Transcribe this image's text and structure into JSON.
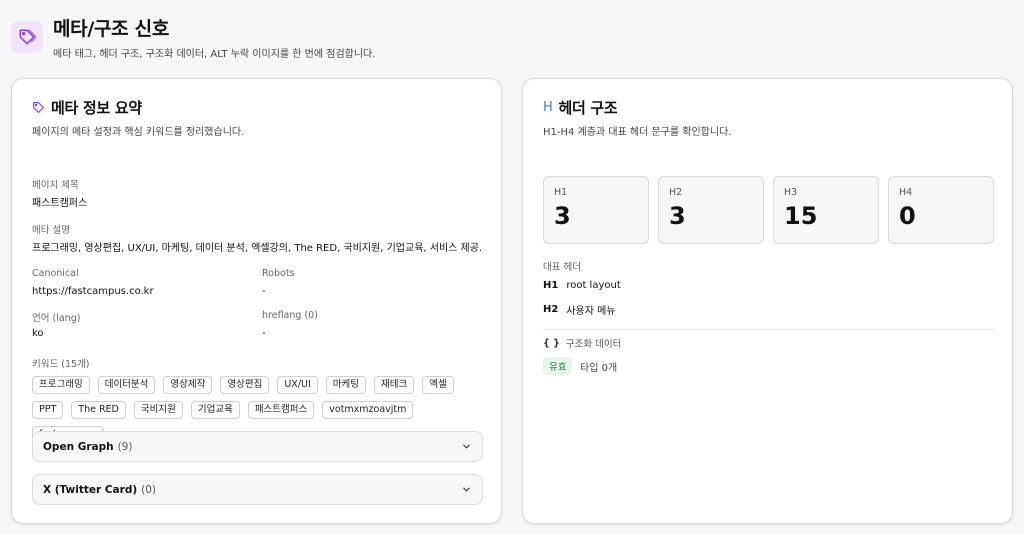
{
  "header": {
    "title": "메타/구조 신호",
    "subtitle": "메타 태그, 헤더 구조, 구조화 데이터, ALT 누락 이미지를 한 번에 점검합니다.",
    "icon": "tag-icon",
    "accent": "#8b3fd6"
  },
  "meta": {
    "title": "메타 정보 요약",
    "desc": "페이지의 메타 설정과 핵심 키워드를 정리했습니다.",
    "page_title_label": "페이지 제목",
    "page_title": "패스트캠퍼스",
    "meta_desc_label": "메타 설명",
    "meta_desc": "프로그래밍, 영상편집, UX/UI, 마케팅, 데이터 분석, 엑셀강의, The RED, 국비지원, 기업교육, 서비스 제공.",
    "canonical_label": "Canonical",
    "canonical": "https://fastcampus.co.kr",
    "robots_label": "Robots",
    "robots": "-",
    "lang_label": "언어 (lang)",
    "lang": "ko",
    "hreflang_label": "hreflang (0)",
    "hreflang": "-",
    "keywords_label": "키워드 (15개)",
    "keywords": [
      "프로그래밍",
      "데이터분석",
      "영상제작",
      "영상편집",
      "UX/UI",
      "마케팅",
      "재테크",
      "엑셀",
      "PPT",
      "The RED",
      "국비지원",
      "기업교육",
      "패스트캠퍼스",
      "votmxmzoavjtm",
      "fastcampus."
    ],
    "og_label": "Open Graph",
    "og_count": "(9)",
    "twitter_label": "X (Twitter Card)",
    "twitter_count": "(0)"
  },
  "headers": {
    "title": "헤더 구조",
    "title_icon": "H",
    "desc": "H1-H4 계층과 대표 헤더 문구를 확인합니다.",
    "counts": [
      {
        "label": "H1",
        "value": "3"
      },
      {
        "label": "H2",
        "value": "3"
      },
      {
        "label": "H3",
        "value": "15"
      },
      {
        "label": "H4",
        "value": "0"
      }
    ],
    "rep_label": "대표 헤더",
    "rep": [
      {
        "tag": "H1",
        "text": "root layout"
      },
      {
        "tag": "H2",
        "text": "사용자 메뉴"
      }
    ],
    "sd_icon": "{ }",
    "sd_label": "구조화 데이터",
    "sd_badge": "유효",
    "sd_types": "타입 0개"
  }
}
